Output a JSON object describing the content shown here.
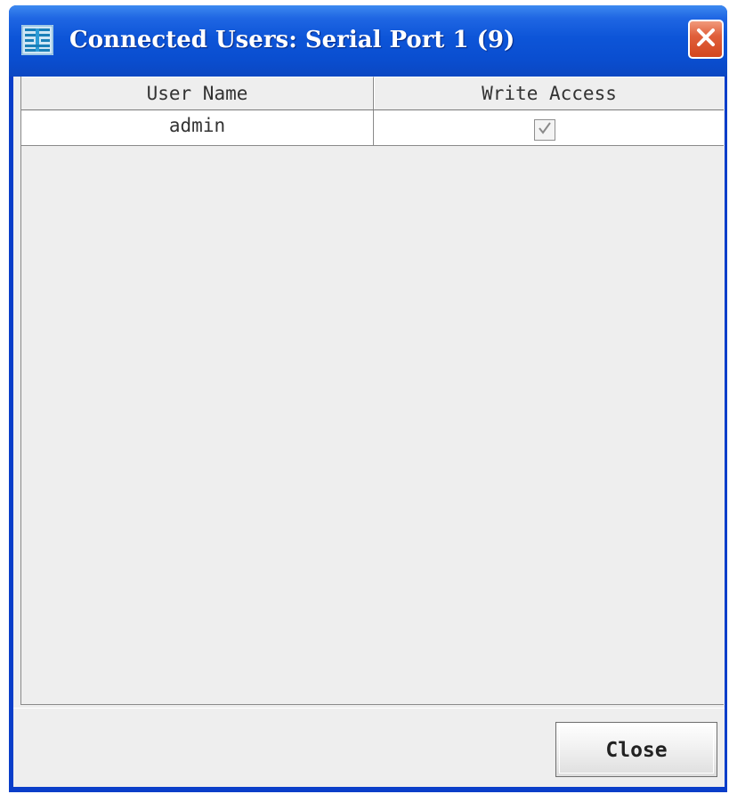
{
  "window": {
    "title": "Connected Users: Serial Port 1 (9)",
    "app_icon": "serial-port-icon",
    "close_icon": "close-icon",
    "colors": {
      "title_bar": "#0a4ed0",
      "close_button": "#e0603c",
      "client_bg": "#eeeeee"
    }
  },
  "table": {
    "columns": [
      "User Name",
      "Write Access"
    ],
    "rows": [
      {
        "user_name": "admin",
        "write_access": true
      }
    ]
  },
  "footer": {
    "close_label": "Close"
  }
}
